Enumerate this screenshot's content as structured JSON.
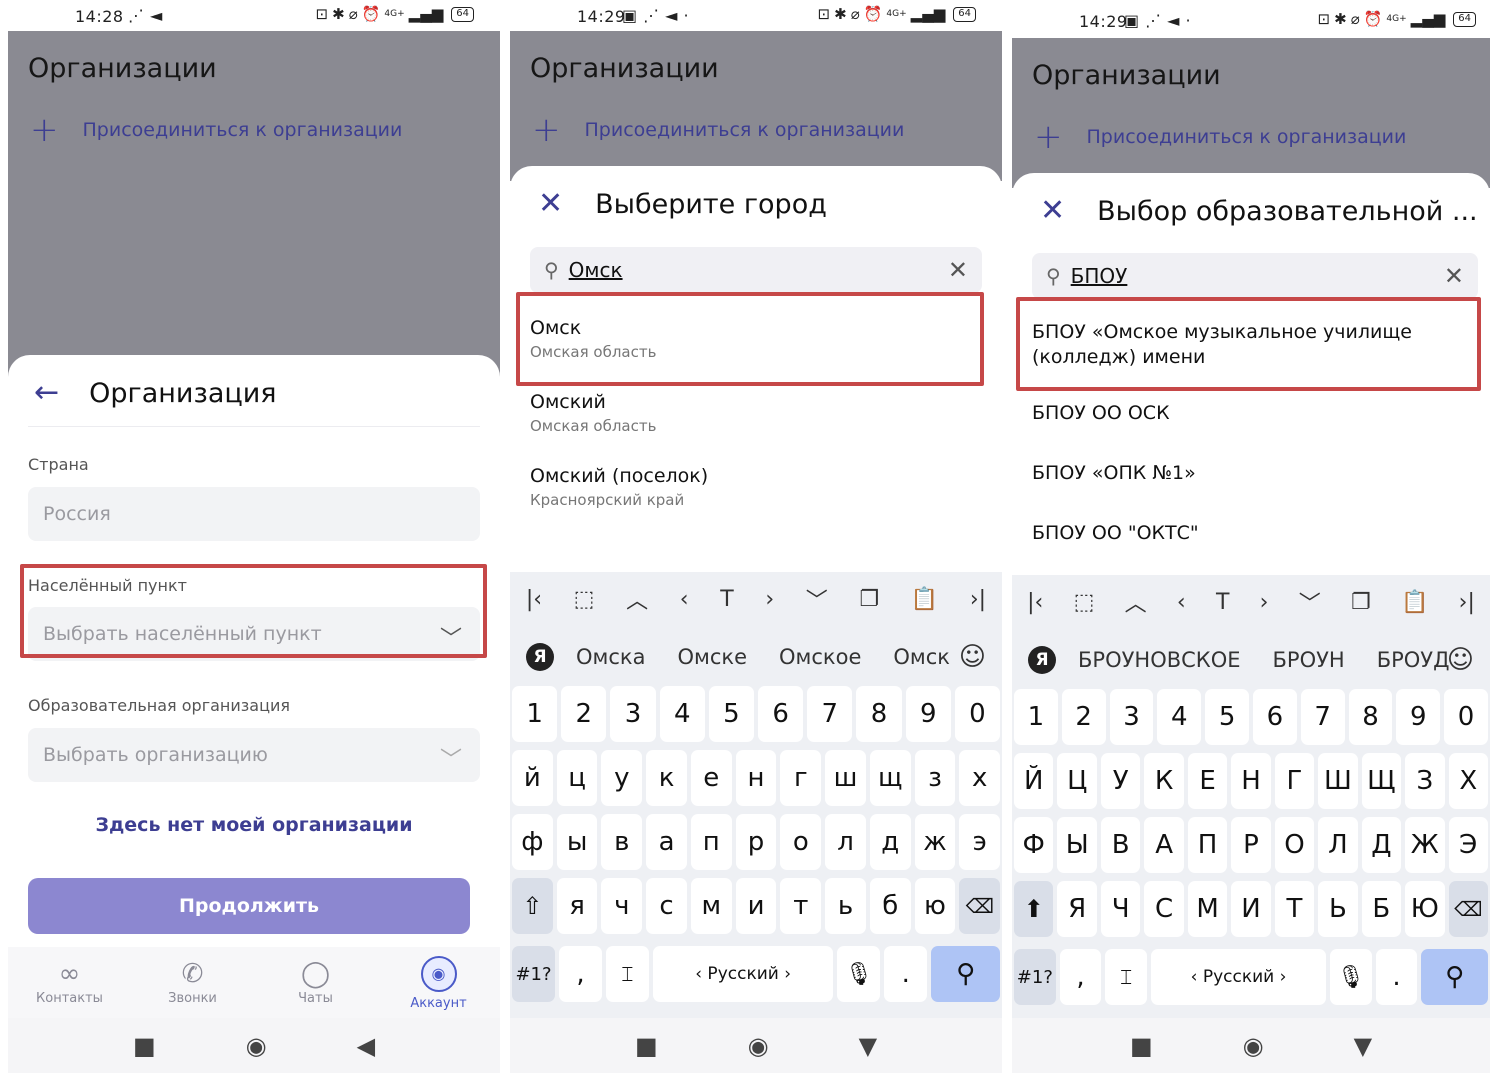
{
  "status": {
    "p1_time": "14:28",
    "p2_time": "14:29",
    "p3_time": "14:29",
    "net": "4G+",
    "battery": "64"
  },
  "background": {
    "title": "Организации",
    "join_label": "Присоединиться к организации"
  },
  "screen1": {
    "title": "Организация",
    "country_label": "Страна",
    "country_value": "Россия",
    "locality_label": "Населённый пункт",
    "locality_placeholder": "Выбрать населённый пункт",
    "edu_label": "Образовательная организация",
    "edu_placeholder": "Выбрать организацию",
    "not_found_link": "Здесь нет моей организации",
    "continue_button": "Продолжить",
    "tabs": [
      {
        "label": "Контакты",
        "icon": "contacts-icon"
      },
      {
        "label": "Звонки",
        "icon": "phone-icon"
      },
      {
        "label": "Чаты",
        "icon": "chat-icon"
      },
      {
        "label": "Аккаунт",
        "icon": "camera-icon"
      }
    ]
  },
  "screen2": {
    "title": "Выберите город",
    "search_query": "Омск",
    "results": [
      {
        "name": "Омск",
        "region": "Омская область"
      },
      {
        "name": "Омский",
        "region": "Омская область"
      },
      {
        "name": "Омский (поселок)",
        "region": "Красноярский край"
      }
    ],
    "suggestions": [
      "Омска",
      "Омске",
      "Омское",
      "Омск"
    ]
  },
  "screen3": {
    "title": "Выбор образовательной ...",
    "search_query": "БПОУ",
    "results": [
      {
        "name": "БПОУ «Омское музыкальное училище (колледж) имени"
      },
      {
        "name": "БПОУ ОО ОСК"
      },
      {
        "name": "БПОУ «ОПК №1»"
      },
      {
        "name": "БПОУ ОО \"ОКТС\""
      }
    ],
    "suggestions": [
      "БРОУНОВСКОЕ",
      "БРОУН",
      "БРОУД"
    ]
  },
  "keyboard": {
    "digits": [
      "1",
      "2",
      "3",
      "4",
      "5",
      "6",
      "7",
      "8",
      "9",
      "0"
    ],
    "row1": [
      "й",
      "ц",
      "у",
      "к",
      "е",
      "н",
      "г",
      "ш",
      "щ",
      "з",
      "х"
    ],
    "row2": [
      "ф",
      "ы",
      "в",
      "а",
      "п",
      "р",
      "о",
      "л",
      "д",
      "ж",
      "э"
    ],
    "row3": [
      "я",
      "ч",
      "с",
      "м",
      "и",
      "т",
      "ь",
      "б",
      "ю"
    ],
    "row1_upper": [
      "Й",
      "Ц",
      "У",
      "К",
      "Е",
      "Н",
      "Г",
      "Ш",
      "Щ",
      "З",
      "Х"
    ],
    "row2_upper": [
      "Ф",
      "Ы",
      "В",
      "А",
      "П",
      "Р",
      "О",
      "Л",
      "Д",
      "Ж",
      "Э"
    ],
    "row3_upper": [
      "Я",
      "Ч",
      "С",
      "М",
      "И",
      "Т",
      "Ь",
      "Б",
      "Ю"
    ],
    "symbols_key": "#1?",
    "space_label": "‹ Русский ›",
    "comma": ",",
    "period": "."
  },
  "colors": {
    "accent": "#3d3e92",
    "highlight": "#c64848",
    "button": "#8c87d0",
    "dim": "#8a8a92"
  }
}
